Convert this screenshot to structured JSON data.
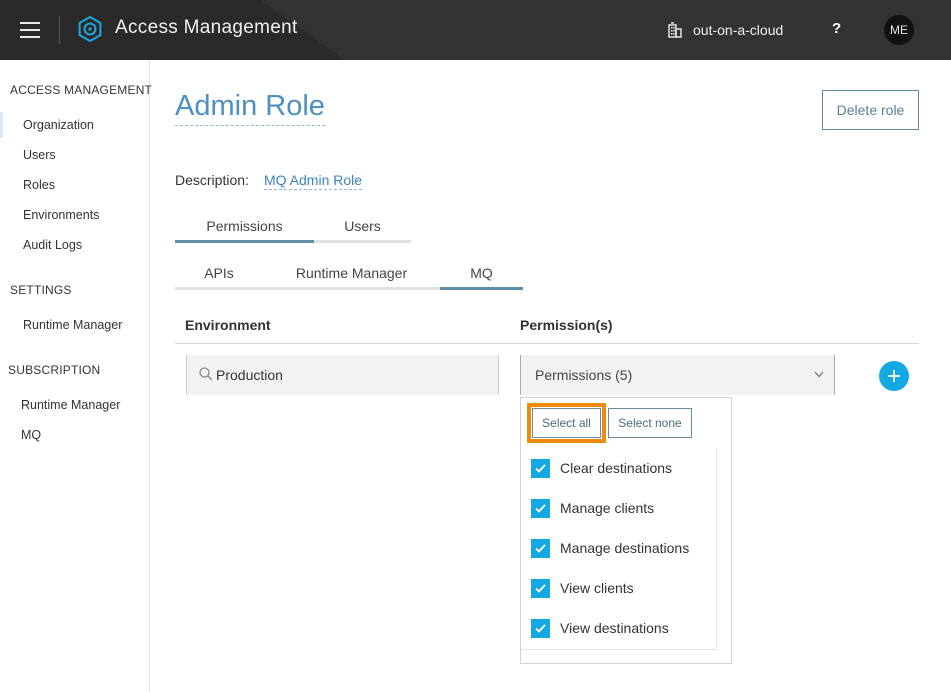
{
  "header": {
    "menu_icon": "hamburger-icon",
    "logo_icon": "gear-logo-icon",
    "title": "Access Management",
    "org_icon": "building-icon",
    "org_name": "out-on-a-cloud",
    "help_label": "?",
    "avatar_initials": "ME"
  },
  "sidebar": {
    "sections": [
      {
        "heading": "ACCESS MANAGEMENT",
        "items": [
          "Organization",
          "Users",
          "Roles",
          "Environments",
          "Audit Logs"
        ]
      },
      {
        "heading": "SETTINGS",
        "items": [
          "Runtime Manager"
        ]
      },
      {
        "heading": "SUBSCRIPTION",
        "items": [
          "Runtime Manager",
          "MQ"
        ]
      }
    ],
    "active_item": "Organization"
  },
  "main": {
    "title": "Admin Role",
    "delete_button": "Delete role",
    "description_label": "Description:",
    "description_value": "MQ Admin Role",
    "tabs": [
      {
        "label": "Permissions",
        "active": true
      },
      {
        "label": "Users",
        "active": false
      }
    ],
    "subtabs": [
      {
        "label": "APIs",
        "active": false
      },
      {
        "label": "Runtime Manager",
        "active": false
      },
      {
        "label": "MQ",
        "active": true
      }
    ],
    "columns": {
      "environment": "Environment",
      "permissions": "Permission(s)"
    },
    "env_input": {
      "value": "Production",
      "search_icon": "search-icon",
      "clear_icon": "close-icon"
    },
    "perm_select": {
      "value": "Permissions (5)",
      "chevron_icon": "chevron-down-icon"
    },
    "add_icon": "plus-icon",
    "dropdown": {
      "select_all": "Select all",
      "select_none": "Select none",
      "options": [
        {
          "label": "Clear destinations",
          "checked": true
        },
        {
          "label": "Manage clients",
          "checked": true
        },
        {
          "label": "Manage destinations",
          "checked": true
        },
        {
          "label": "View clients",
          "checked": true
        },
        {
          "label": "View destinations",
          "checked": true
        }
      ]
    }
  },
  "colors": {
    "topbar": "#2a2a2a",
    "accent": "#14a9e3",
    "title_blue": "#4f8fc2",
    "highlight_orange": "#f08a0c"
  }
}
